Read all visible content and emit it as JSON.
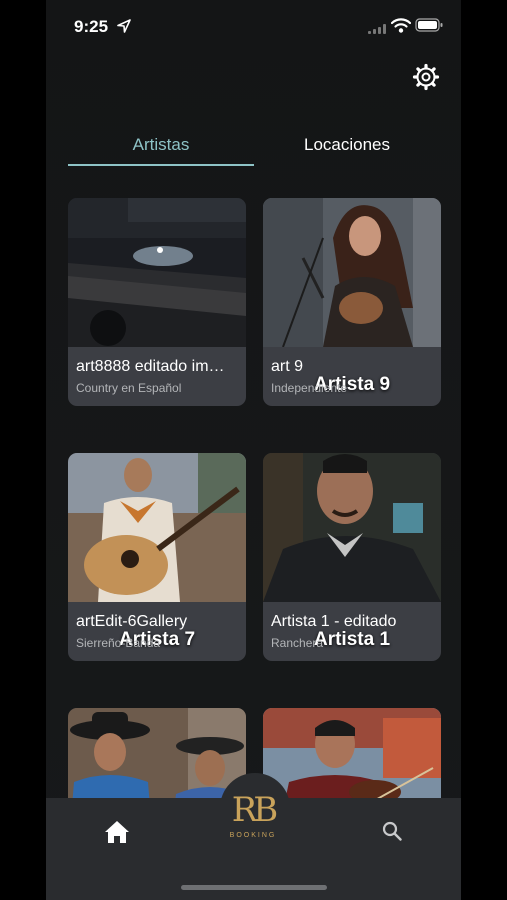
{
  "status_bar": {
    "time": "9:25"
  },
  "tabs": [
    {
      "label": "Artistas",
      "active": true
    },
    {
      "label": "Locaciones",
      "active": false
    }
  ],
  "cards": [
    {
      "title": "art8888 editado im…",
      "subtitle": "Country en Español",
      "overlay": ""
    },
    {
      "title": "art 9",
      "subtitle": "Independiente",
      "overlay": "Artista 9"
    },
    {
      "title": "artEdit-6Gallery",
      "subtitle": "Sierreño-Banda",
      "overlay": "Artista 7"
    },
    {
      "title": "Artista 1 - editado",
      "subtitle": "Ranchera",
      "overlay": "Artista 1"
    }
  ],
  "logo": {
    "mark": "RB",
    "text": "BOOKING"
  },
  "colors": {
    "accent": "#8ec3c6",
    "gold": "#c9a35b",
    "card_bg": "#3c3e44",
    "nav_bg": "#2a2c2f"
  }
}
